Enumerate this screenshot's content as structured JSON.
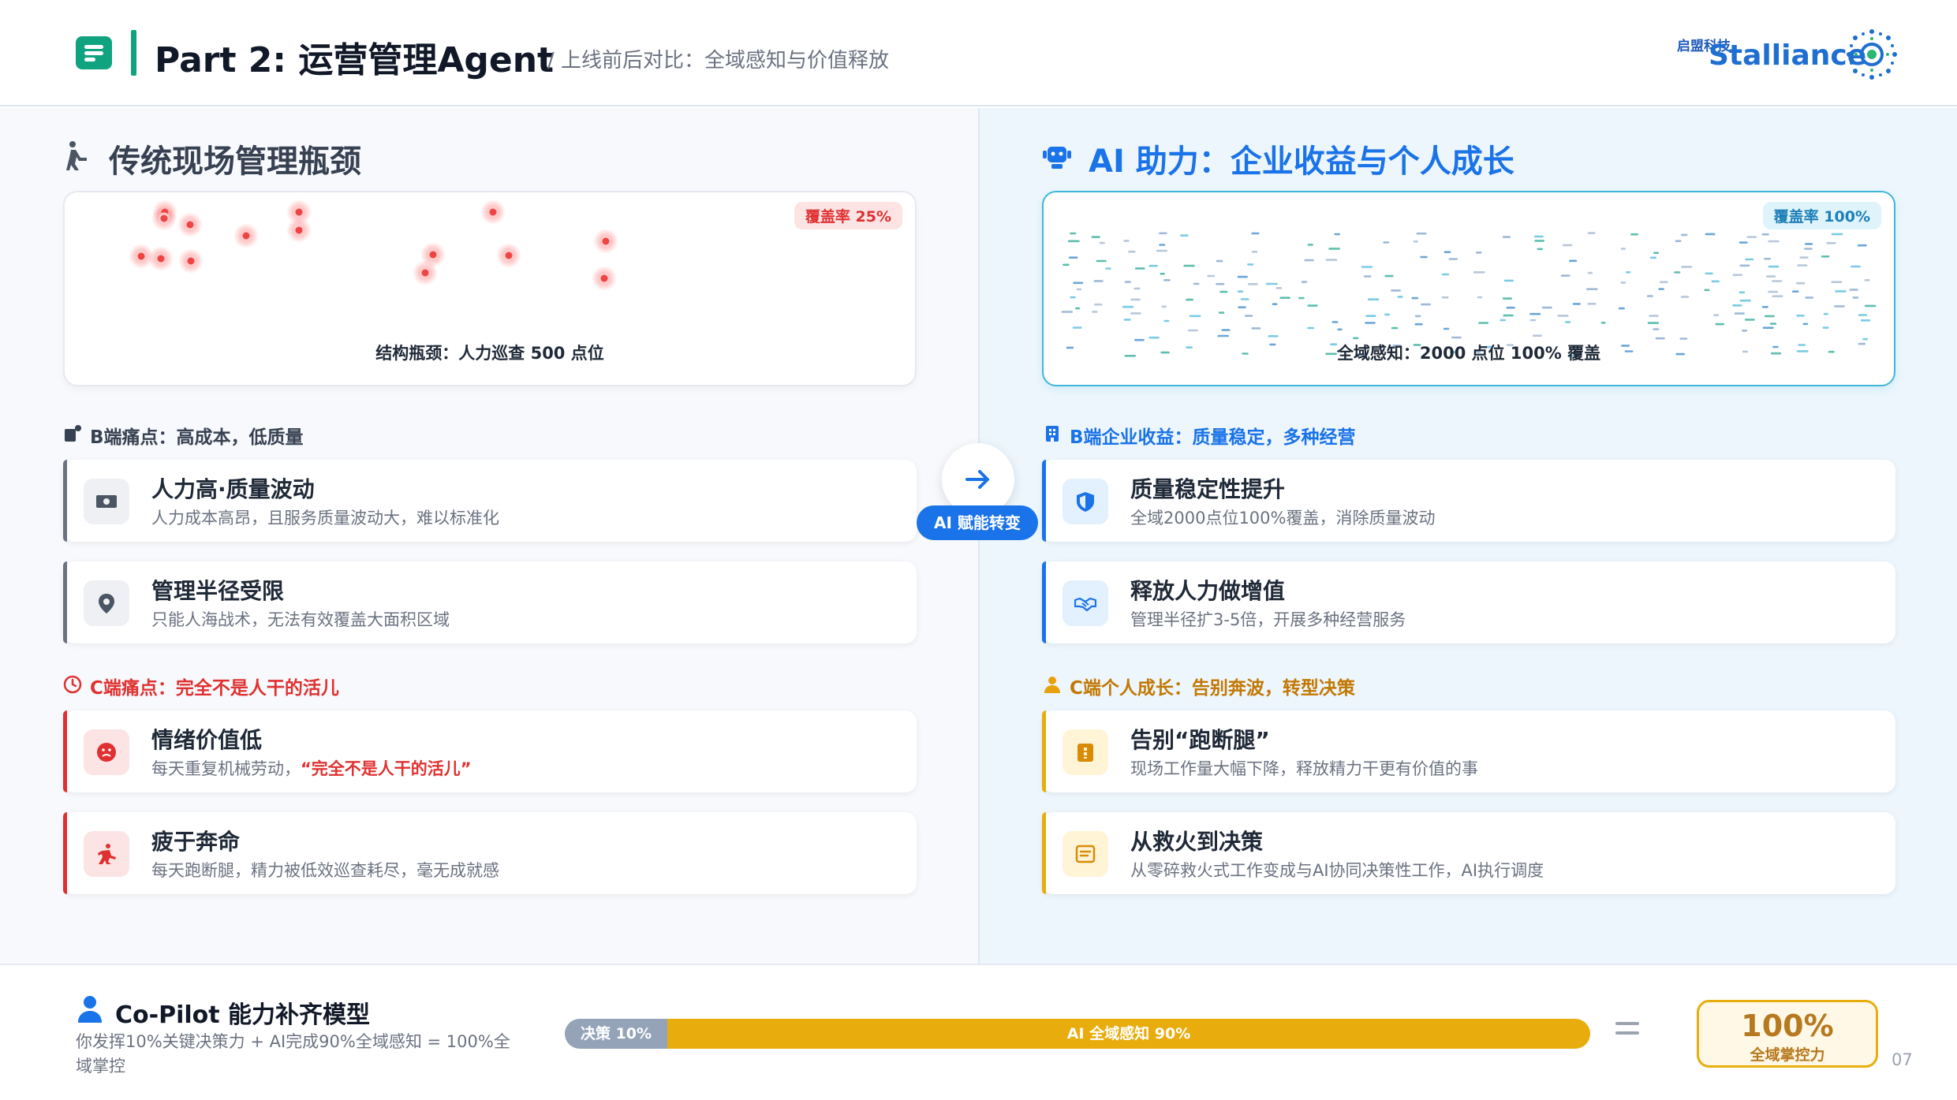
{
  "header": {
    "title": "Part 2: 运营管理Agent",
    "subtitle": "/ 上线前后对比：全域感知与价值释放",
    "logo_cn": "启盟科技",
    "logo_en": "Stalliance"
  },
  "left": {
    "title": "传统现场管理瓶颈",
    "viz": {
      "badge": "覆盖率 25%",
      "caption": "结构瓶颈：人力巡查 500 点位"
    },
    "b_head": "B端痛点：高成本，低质量",
    "c_head": "C端痛点：完全不是人干的活儿",
    "cards": [
      {
        "title": "人力高·质量波动",
        "desc": "人力成本高昂，且服务质量波动大，难以标准化"
      },
      {
        "title": "管理半径受限",
        "desc": "只能人海战术，无法有效覆盖大面积区域"
      },
      {
        "title": "情绪价值低",
        "desc": "每天重复机械劳动，",
        "desc_highlight": "“完全不是人干的活儿”"
      },
      {
        "title": "疲于奔命",
        "desc": "每天跑断腿，精力被低效巡查耗尽，毫无成就感"
      }
    ]
  },
  "center": {
    "label": "AI 赋能转变"
  },
  "right": {
    "title": "AI 助力：企业收益与个人成长",
    "viz": {
      "badge": "覆盖率 100%",
      "caption": "全域感知：2000 点位 100% 覆盖"
    },
    "b_head": "B端企业收益：质量稳定，多种经营",
    "c_head": "C端个人成长：告别奔波，转型决策",
    "cards": [
      {
        "title": "质量稳定性提升",
        "desc": "全域2000点位100%覆盖，消除质量波动"
      },
      {
        "title": "释放人力做增值",
        "desc": "管理半径扩3-5倍，开展多种经营服务"
      },
      {
        "title": "告别“跑断腿”",
        "desc": "现场工作量大幅下降，释放精力干更有价值的事"
      },
      {
        "title": "从救火到决策",
        "desc": "从零碎救火式工作变成与AI协同决策性工作，AI执行调度"
      }
    ]
  },
  "footer": {
    "title": "Co-Pilot 能力补齐模型",
    "desc": "你发挥10%关键决策力 + AI完成90%全域感知 = 100%全域掌控",
    "bar": {
      "decision_label": "决策 10%",
      "decision_share": 0.1,
      "ai_label": "AI 全域感知 90%",
      "ai_share": 0.9
    },
    "result_value": "100%",
    "result_label": "全域掌控力",
    "page": "07"
  },
  "colors": {
    "brand_green": "#10a37f",
    "accent_blue": "#1a73e8",
    "pain_red": "#e03131",
    "growth_amber": "#e8ad0c"
  }
}
